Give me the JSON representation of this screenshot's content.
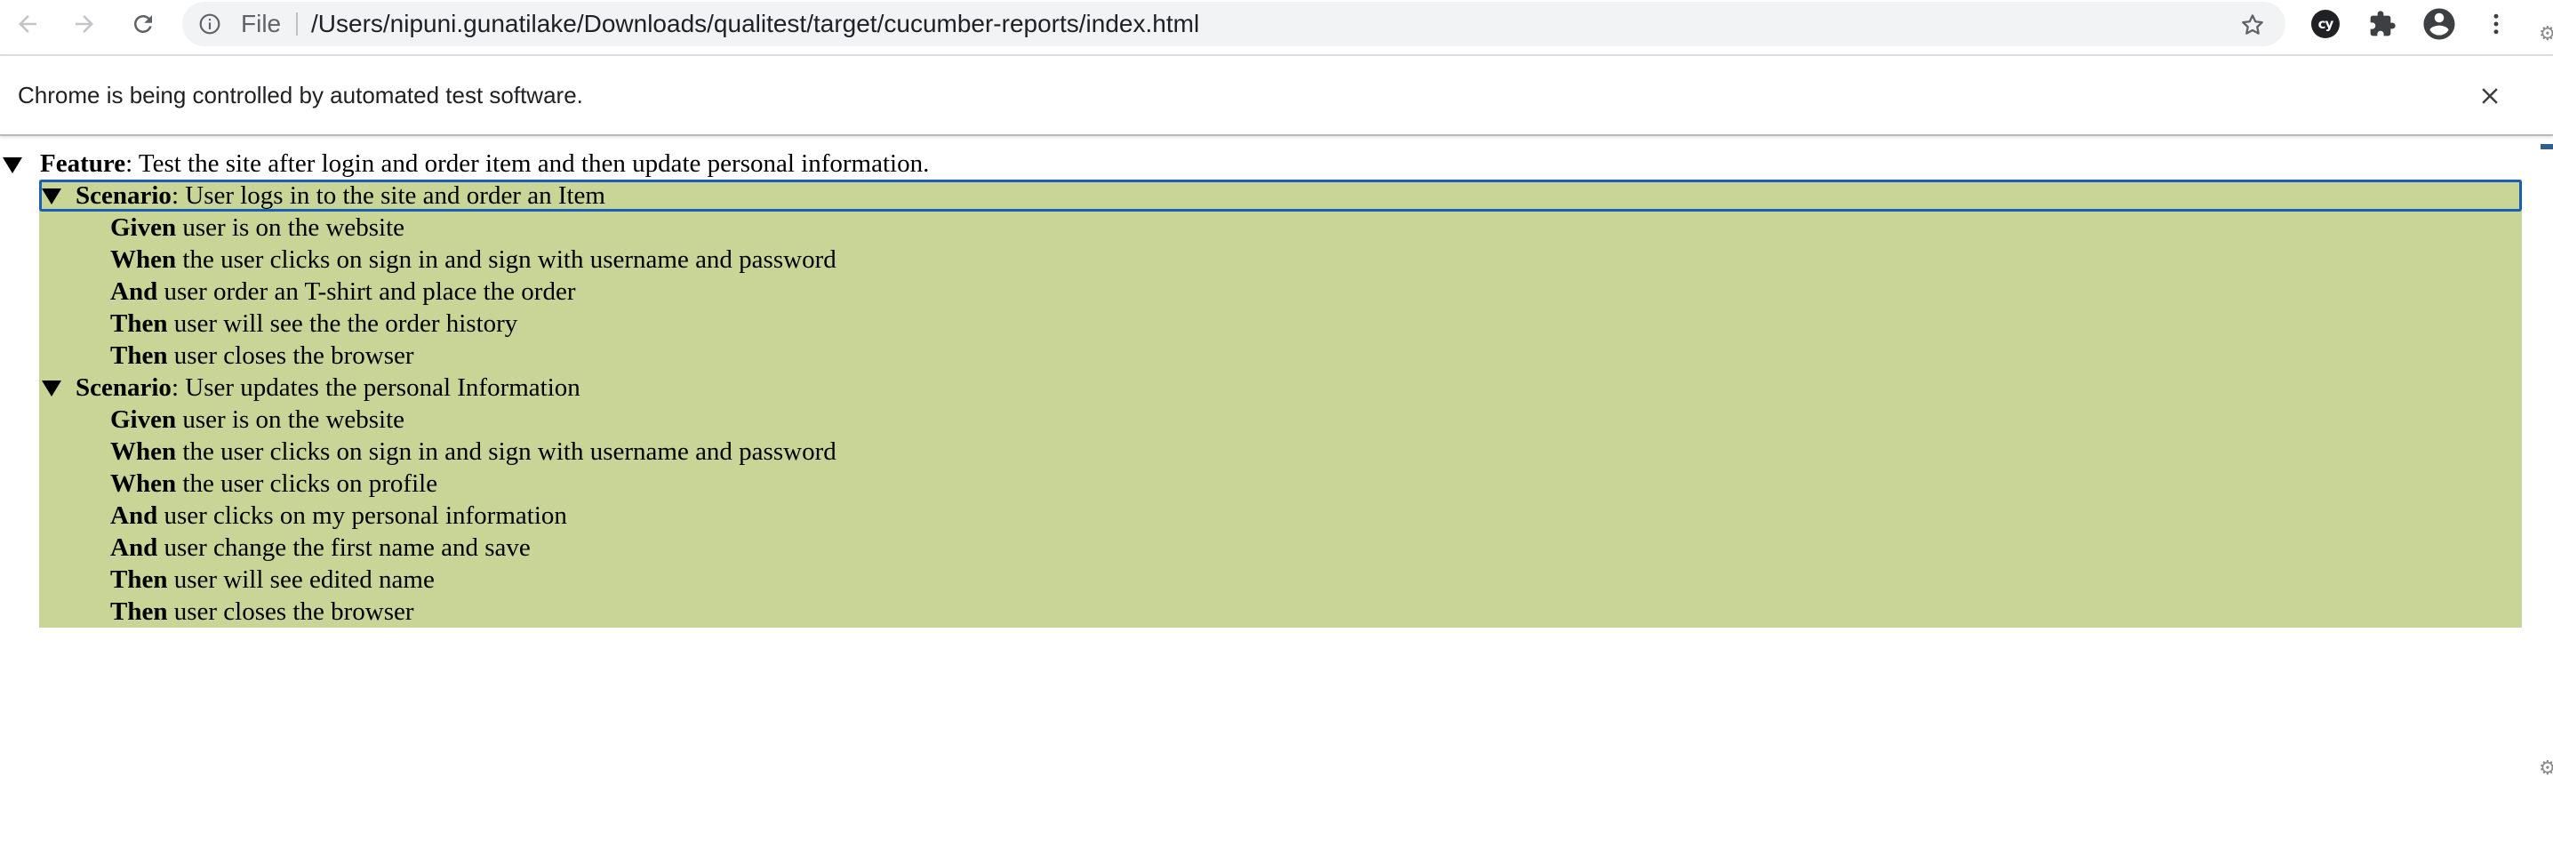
{
  "browser": {
    "scheme_label": "File",
    "url": "/Users/nipuni.gunatilake/Downloads/qualitest/target/cucumber-reports/index.html",
    "extension_badge": "cy",
    "icons": {
      "back": "back-arrow-icon",
      "forward": "forward-arrow-icon",
      "reload": "reload-icon",
      "info": "info-icon",
      "bookmark": "star-icon",
      "extensions": "puzzle-icon",
      "profile": "account-circle-icon",
      "menu": "kebab-menu-icon"
    }
  },
  "infobar": {
    "message": "Chrome is being controlled by automated test software."
  },
  "report": {
    "colors": {
      "passed_background": "#c9d596",
      "focus_outline": "#1a5fb4"
    },
    "feature": {
      "keyword": "Feature",
      "name": ": Test the site after login and order item and then update personal information."
    },
    "scenarios": [
      {
        "keyword": "Scenario",
        "name": ": User logs in to the site and order an Item",
        "steps": [
          {
            "keyword": "Given",
            "text": " user is on the website"
          },
          {
            "keyword": "When",
            "text": " the user clicks on sign in and sign with username and password"
          },
          {
            "keyword": "And",
            "text": " user order an T-shirt and place the order"
          },
          {
            "keyword": "Then",
            "text": " user will see the the order history"
          },
          {
            "keyword": "Then",
            "text": " user closes the browser"
          }
        ]
      },
      {
        "keyword": "Scenario",
        "name": ": User updates the personal Information",
        "steps": [
          {
            "keyword": "Given",
            "text": " user is on the website"
          },
          {
            "keyword": "When",
            "text": " the user clicks on sign in and sign with username and password"
          },
          {
            "keyword": "When",
            "text": " the user clicks on profile"
          },
          {
            "keyword": "And",
            "text": " user clicks on my personal information"
          },
          {
            "keyword": "And",
            "text": " user change the first name and save"
          },
          {
            "keyword": "Then",
            "text": " user will see edited name"
          },
          {
            "keyword": "Then",
            "text": " user closes the browser"
          }
        ]
      }
    ]
  }
}
